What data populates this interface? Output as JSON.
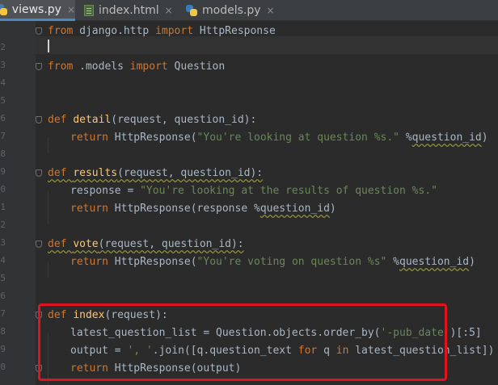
{
  "tabs": [
    {
      "label": "views.py",
      "close": "×"
    },
    {
      "label": "index.html",
      "close": "×"
    },
    {
      "label": "models.py",
      "close": "×"
    }
  ],
  "gutter": [
    "",
    "2",
    "3",
    "4",
    "5",
    "6",
    "7",
    "8",
    "9",
    "0",
    "1",
    "2",
    "3",
    "4",
    "5",
    "6",
    "7",
    "8",
    "9",
    "0"
  ],
  "code": {
    "l1": {
      "a": "from",
      "b": " django.http ",
      "c": "import",
      "d": " HttpResponse"
    },
    "l3": {
      "a": "from",
      "b": " .models ",
      "c": "import",
      "d": " Question"
    },
    "l6": {
      "a": "def ",
      "b": "detail",
      "c": "(request, question_id):"
    },
    "l7": {
      "a": "return",
      "b": " HttpResponse(",
      "c": "\"You're looking at question %s.\"",
      "d": " %",
      "e": "question_id",
      ")": ")"
    },
    "l9": {
      "a": "def ",
      "b": "results",
      "c": "(request, question_id):"
    },
    "l10": {
      "a": "response = ",
      "b": "\"You're looking at the results of question %s.\""
    },
    "l11": {
      "a": "return",
      "b": " HttpResponse(response %",
      "c": "question_id",
      ")": ")"
    },
    "l13": {
      "a": "def ",
      "b": "vote",
      "c": "(request, question_id):"
    },
    "l14": {
      "a": "return",
      "b": " HttpResponse(",
      "c": "\"You're voting on question %s\"",
      "d": " %",
      "e": "question_id",
      ")": ")"
    },
    "l17": {
      "a": "def ",
      "b": "index",
      "c": "(request):"
    },
    "l18": {
      "a": "latest_question_list = Question.objects.order_by(",
      "b": "'-pub_date'",
      "c": ")[:5]"
    },
    "l19": {
      "a": "output = ",
      "b": "', '",
      "c": ".join([q.question_text ",
      "d": "for",
      "e": " q ",
      "f": "in",
      "g": " latest_question_list])"
    },
    "l20": {
      "a": "return",
      "b": " HttpResponse(output)"
    }
  },
  "colors": {
    "keyword": "#cc7832",
    "function": "#ffc66d",
    "string": "#6a8759",
    "text": "#a9b7c6",
    "highlight_box": "#e0141e"
  },
  "icons": [
    "python-file-icon",
    "html-file-icon",
    "close-icon"
  ]
}
